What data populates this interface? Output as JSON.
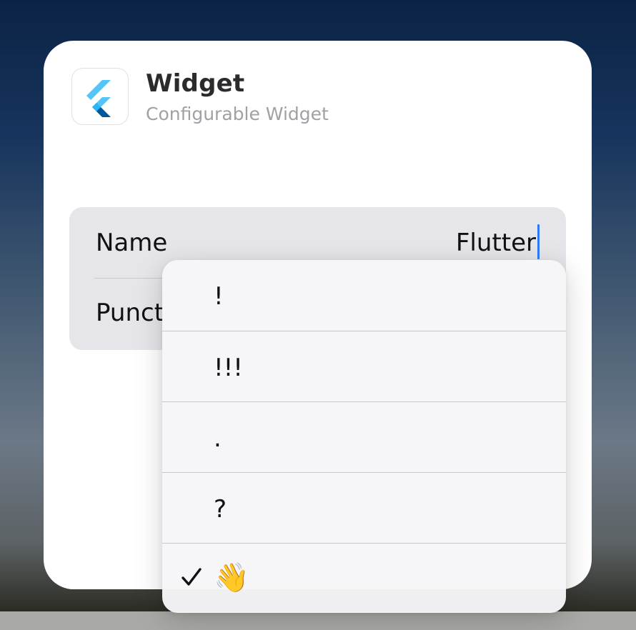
{
  "app": {
    "title": "Widget",
    "subtitle": "Configurable Widget",
    "icon": "flutter-logo-icon"
  },
  "settings": {
    "name_label": "Name",
    "name_value": "Flutter",
    "punctuation_label": "Punct"
  },
  "menu": {
    "items": [
      {
        "label": "!",
        "selected": false
      },
      {
        "label": "!!!",
        "selected": false
      },
      {
        "label": ".",
        "selected": false
      },
      {
        "label": "?",
        "selected": false
      },
      {
        "label": "👋",
        "selected": true
      }
    ],
    "check_icon": "checkmark-icon"
  },
  "colors": {
    "accent_cursor": "#2f7bf5",
    "flutter_light": "#54c5f8",
    "flutter_dark": "#01579b"
  }
}
